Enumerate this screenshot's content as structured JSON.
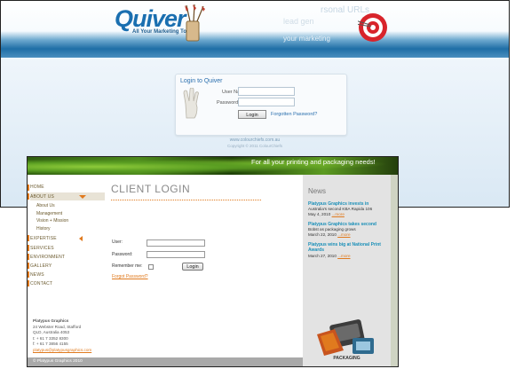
{
  "quiver": {
    "logo": "Quiver",
    "tagline": "All Your Marketing Tools",
    "bg_words": [
      "rsonal URLs",
      "lead gen",
      "your marketing"
    ],
    "login": {
      "title": "Login to Quiver",
      "username_label": "User Name",
      "password_label": "Password",
      "button": "Login",
      "forgot": "Forgotten Password?"
    },
    "footer_url": "www.colourchiefs.com.au",
    "footer_copy": "Copyright © 2011 ColourChiefs"
  },
  "platypus": {
    "tagline": "For all your printing and packaging needs!",
    "nav": {
      "home": "HOME",
      "about": "ABOUT US",
      "about_sub": [
        "About Us",
        "Management",
        "Vision + Mission",
        "History"
      ],
      "expertise": "EXPERTISE",
      "services": "SERVICES",
      "environment": "ENVIRONMENT",
      "gallery": "GALLERY",
      "news": "NEWS",
      "contact": "CONTACT"
    },
    "address": {
      "name": "Platypus Graphics",
      "street": "24 Webster Road, Stafford",
      "city": "QLD, Australia 4053",
      "phone": "t: + 61 7 3352 8300",
      "fax": "f: + 61 7 3856 4155",
      "email": "platypus@platypusgraphics.com"
    },
    "copyright": "© Platypus Graphics 2010",
    "login": {
      "title": "CLIENT LOGIN",
      "user_label": "User:",
      "password_label": "Password:",
      "remember_label": "Remember me:",
      "button": "Login",
      "forgot": "Forgot Password?"
    },
    "news": {
      "heading": "News",
      "items": [
        {
          "title": "Platypus Graphics invests in",
          "body": "Australia's second KBA Rapida 106",
          "date": "May 4, 2010",
          "more": "...more"
        },
        {
          "title": "Platypus Graphics takes second",
          "body": "Bobst as packaging grows",
          "date": "March 22, 2010",
          "more": "...more"
        },
        {
          "title": "Platypus wins big at National Print Awards",
          "body": "",
          "date": "March 27, 2010",
          "more": "...more"
        }
      ],
      "image_label": "PACKAGING"
    }
  },
  "colors": {
    "quiver_blue": "#1a6fb0",
    "platypus_orange": "#e07a1e",
    "news_link": "#1a8fb8"
  }
}
